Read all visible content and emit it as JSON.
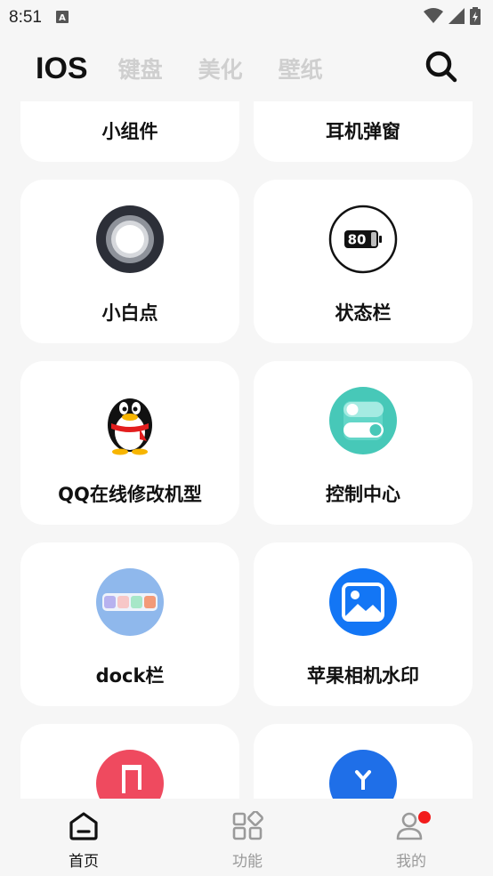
{
  "status_bar": {
    "time": "8:51",
    "notification_icon": "a-box-icon",
    "wifi_icon": "wifi-icon",
    "signal_icon": "signal-icon",
    "battery_icon": "battery-charging-icon"
  },
  "top_nav": {
    "tabs": [
      {
        "label": "IOS",
        "active": true
      },
      {
        "label": "键盘",
        "active": false
      },
      {
        "label": "美化",
        "active": false
      },
      {
        "label": "壁纸",
        "active": false
      }
    ],
    "search_icon": "search-icon"
  },
  "cards": [
    {
      "label": "小组件",
      "icon": "widget-icon"
    },
    {
      "label": "耳机弹窗",
      "icon": "headphone-popup-icon"
    },
    {
      "label": "小白点",
      "icon": "assistive-touch-icon"
    },
    {
      "label": "状态栏",
      "icon": "status-bar-battery-icon",
      "icon_text": "80"
    },
    {
      "label": "QQ在线修改机型",
      "icon": "qq-penguin-icon"
    },
    {
      "label": "控制中心",
      "icon": "control-center-toggle-icon"
    },
    {
      "label": "dock栏",
      "icon": "dock-icon"
    },
    {
      "label": "苹果相机水印",
      "icon": "photo-icon"
    },
    {
      "label": "",
      "icon": "music-icon"
    },
    {
      "label": "",
      "icon": "blue-app-icon"
    }
  ],
  "bottom_nav": {
    "items": [
      {
        "label": "首页",
        "icon": "home-icon",
        "active": true
      },
      {
        "label": "功能",
        "icon": "grid-icon",
        "active": false
      },
      {
        "label": "我的",
        "icon": "profile-icon",
        "active": false,
        "has_badge": true
      }
    ]
  },
  "colors": {
    "background": "#f6f6f6",
    "card": "#ffffff",
    "active_text": "#111111",
    "inactive_tab": "#cfcfcf",
    "badge": "#f21c1c"
  }
}
